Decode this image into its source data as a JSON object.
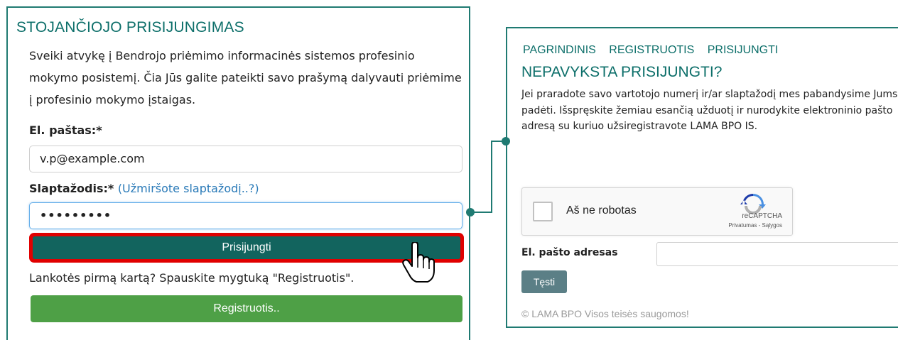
{
  "login": {
    "title": "STOJANČIOJO PRISIJUNGIMAS",
    "intro": "Sveiki atvykę į Bendrojo priėmimo informacinės sistemos profesinio mokymo posistemį. Čia Jūs galite pateikti savo prašymą dalyvauti priėmime į profesinio mokymo įstaigas.",
    "email_label": "El. paštas:*",
    "email_value": "v.p@example.com",
    "password_label": "Slaptažodis:*",
    "forgot_link": "(Užmiršote slaptažodį..?)",
    "password_value": "•••••••••",
    "login_button": "Prisijungti",
    "first_time_text": "Lankotės pirmą kartą? Spauskite mygtuką \"Registruotis\".",
    "register_button": "Registruotis.."
  },
  "recovery": {
    "nav": [
      "PAGRINDINIS",
      "REGISTRUOTIS",
      "PRISIJUNGTI"
    ],
    "title": "NEPAVYKSTA PRISIJUNGTI?",
    "text": "Jei praradote savo vartotojo numerį ir/ar slaptažodį mes pabandysime Jums padėti. Išspręskite žemiau esančią užduotį ir nurodykite elektroninio pašto adresą su kuriuo užsiregistravote LAMA BPO IS.",
    "captcha": {
      "label": "Aš ne robotas",
      "brand": "reCAPTCHA",
      "links": "Privatumas - Sąlygos"
    },
    "email_label": "El. pašto adresas",
    "email_value": "",
    "continue_button": "Tęsti",
    "footer": "© LAMA BPO Visos teisės saugomos!"
  },
  "icons": {
    "cursor": "hand-pointer-icon",
    "captcha_logo": "recaptcha-logo-icon"
  },
  "colors": {
    "accent": "#0d6f6a",
    "login_button": "#12645e",
    "register_button": "#4ea046",
    "highlight": "#e00000",
    "link": "#2a7ab8",
    "continue_button": "#5b7f86"
  }
}
